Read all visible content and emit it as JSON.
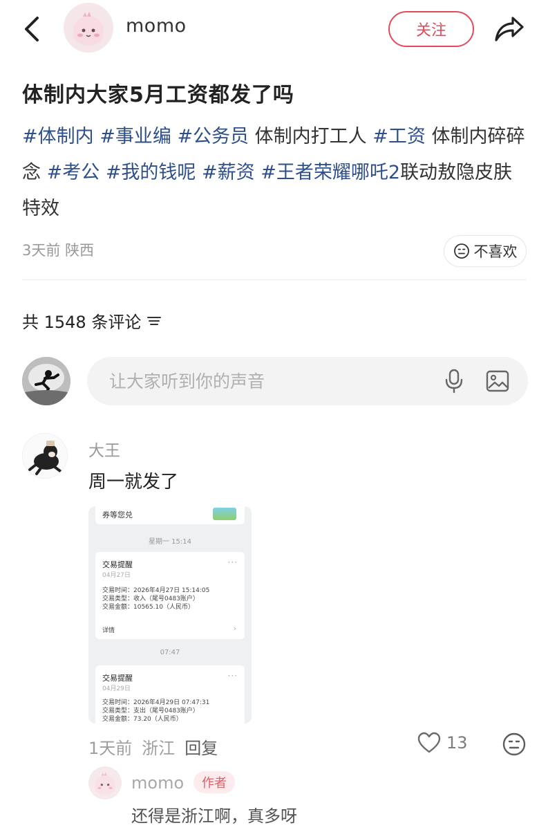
{
  "header": {
    "username": "momo",
    "follow_label": "关注"
  },
  "post": {
    "title": "体制内大家5月工资都发了吗",
    "tags": [
      {
        "text": "#体制内",
        "is_tag": true
      },
      {
        "text": " ",
        "is_tag": false
      },
      {
        "text": "#事业编",
        "is_tag": true
      },
      {
        "text": " ",
        "is_tag": false
      },
      {
        "text": "#公务员",
        "is_tag": true
      },
      {
        "text": " 体制内打工人 ",
        "is_tag": false
      },
      {
        "text": "#工资",
        "is_tag": true
      },
      {
        "text": " 体制内碎碎念 ",
        "is_tag": false
      },
      {
        "text": "#考公",
        "is_tag": true
      },
      {
        "text": " ",
        "is_tag": false
      },
      {
        "text": "#我的钱呢",
        "is_tag": true
      },
      {
        "text": " ",
        "is_tag": false
      },
      {
        "text": "#薪资",
        "is_tag": true
      },
      {
        "text": "  ",
        "is_tag": false
      },
      {
        "text": "#王者荣耀哪吒2",
        "is_tag": true
      },
      {
        "text": "联动敖隐皮肤特效",
        "is_tag": false
      }
    ],
    "time": "3天前",
    "location": "陕西",
    "dislike_label": "不喜欢"
  },
  "comments_section": {
    "count_label": "共 1548 条评论",
    "input_placeholder": "让大家听到你的声音"
  },
  "comment": {
    "author": "大王",
    "text": "周一就发了",
    "time": "1天前",
    "location": "浙江",
    "reply_label": "回复",
    "likes": "13",
    "screenshot": {
      "top_text": "券等您兑",
      "timestamp1": "星期一 15:14",
      "card1": {
        "title": "交易提醒",
        "date": "04月27日",
        "line1": "交易时间：2026年4月27日 15:14:05",
        "line2": "交易类型：收入（尾号0483账户）",
        "line3": "交易金额：10565.10（人民币）",
        "detail": "详情"
      },
      "timestamp2": "07:47",
      "card2": {
        "title": "交易提醒",
        "date": "04月29日",
        "line1": "交易时间：2026年4月29日 07:47:31",
        "line2": "交易类型：支出（尾号0483账户）",
        "line3": "交易金额：73.20（人民币）"
      }
    }
  },
  "reply": {
    "author": "momo",
    "badge": "作者",
    "text": "还得是浙江啊，真多呀"
  },
  "colors": {
    "accent": "#e34a5a",
    "tag_blue": "#2d4f8a",
    "muted": "#999999"
  }
}
